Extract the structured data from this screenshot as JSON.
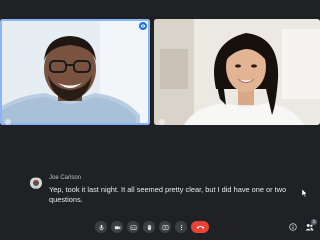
{
  "participants": [
    {
      "name": "Joe Carlson",
      "speaking": true
    },
    {
      "name": "",
      "speaking": false
    }
  ],
  "caption": {
    "speaker": "Joe Carlson",
    "text": "Yep, took it last night. It all seemed pretty clear, but I did have one or two questions."
  },
  "controls": {
    "buttons": [
      "microphone-icon",
      "camera-icon",
      "captions-icon",
      "raise-hand-icon",
      "present-icon",
      "more-options-icon"
    ],
    "end_call": "end-call-icon"
  },
  "right_controls": {
    "participant_count": "2"
  },
  "colors": {
    "background": "#202124",
    "active_speaker_border": "#8ab4f8",
    "end_call": "#ea4335",
    "button": "#3c4043"
  }
}
